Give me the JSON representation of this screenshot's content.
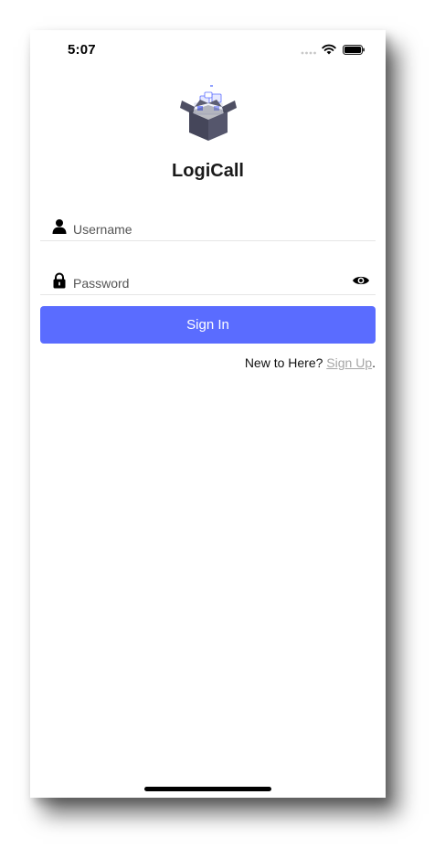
{
  "status_bar": {
    "time": "5:07"
  },
  "app": {
    "title": "LogiCall",
    "logo_icon": "open-box-icon"
  },
  "login_form": {
    "username": {
      "icon": "user-icon",
      "placeholder": "Username",
      "value": ""
    },
    "password": {
      "icon": "lock-icon",
      "placeholder": "Password",
      "value": "",
      "toggle_icon": "eye-icon"
    },
    "submit_label": "Sign In"
  },
  "signup": {
    "prompt": "New to Here? ",
    "link_label": "Sign Up",
    "suffix": "."
  },
  "colors": {
    "primary": "#5a6cff",
    "link_muted": "#a6a6a6",
    "background": "#ffffff"
  }
}
